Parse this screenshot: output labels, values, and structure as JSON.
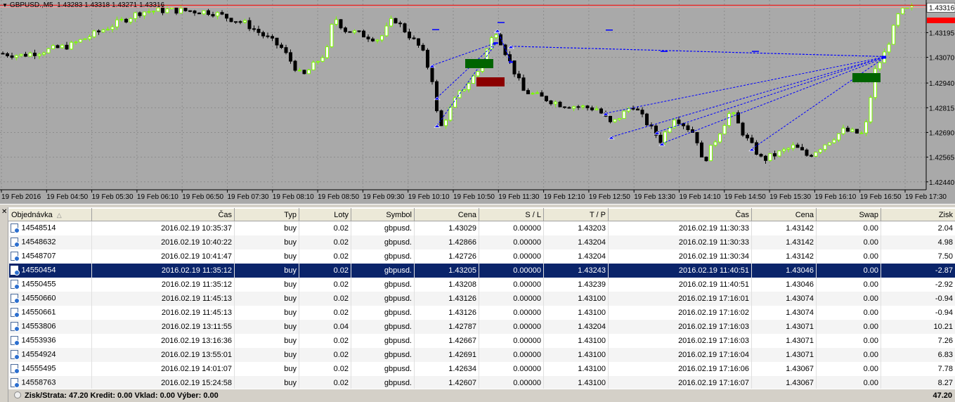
{
  "chart": {
    "symbol_label": "GBPUSD.,M5",
    "ohlc": "1.43283 1.43318 1.43271 1.43316",
    "current_price": "1.43316",
    "price_axis": [
      "1.43195",
      "1.43070",
      "1.42940",
      "1.42815",
      "1.42690",
      "1.42565",
      "1.42440"
    ],
    "time_axis": [
      "19 Feb 2016",
      "19 Feb 04:50",
      "19 Feb 05:30",
      "19 Feb 06:10",
      "19 Feb 06:50",
      "19 Feb 07:30",
      "19 Feb 08:10",
      "19 Feb 08:50",
      "19 Feb 09:30",
      "19 Feb 10:10",
      "19 Feb 10:50",
      "19 Feb 11:30",
      "19 Feb 12:10",
      "19 Feb 12:50",
      "19 Feb 13:30",
      "19 Feb 14:10",
      "19 Feb 14:50",
      "19 Feb 15:30",
      "19 Feb 16:10",
      "19 Feb 16:50",
      "19 Feb 17:30"
    ],
    "colors": {
      "background": "#a9a9a9",
      "bull": "#7cfc00",
      "bear": "#000000",
      "price_line": "#ff0000",
      "trade_line": "#0000ff",
      "tp_box": "#006400",
      "sl_box": "#8b0000"
    }
  },
  "table": {
    "headers": {
      "order": "Objednávka",
      "open_time": "Čas",
      "type": "Typ",
      "lots": "Loty",
      "symbol": "Symbol",
      "open_price": "Cena",
      "sl": "S / L",
      "tp": "T / P",
      "close_time": "Čas",
      "close_price": "Cena",
      "swap": "Swap",
      "profit": "Zisk"
    },
    "rows": [
      {
        "order": "14548514",
        "open_time": "2016.02.19 10:35:37",
        "type": "buy",
        "lots": "0.02",
        "symbol": "gbpusd.",
        "open_price": "1.43029",
        "sl": "0.00000",
        "tp": "1.43203",
        "close_time": "2016.02.19 11:30:33",
        "close_price": "1.43142",
        "swap": "0.00",
        "profit": "2.04"
      },
      {
        "order": "14548632",
        "open_time": "2016.02.19 10:40:22",
        "type": "buy",
        "lots": "0.02",
        "symbol": "gbpusd.",
        "open_price": "1.42866",
        "sl": "0.00000",
        "tp": "1.43204",
        "close_time": "2016.02.19 11:30:33",
        "close_price": "1.43142",
        "swap": "0.00",
        "profit": "4.98"
      },
      {
        "order": "14548707",
        "open_time": "2016.02.19 10:41:47",
        "type": "buy",
        "lots": "0.02",
        "symbol": "gbpusd.",
        "open_price": "1.42726",
        "sl": "0.00000",
        "tp": "1.43204",
        "close_time": "2016.02.19 11:30:34",
        "close_price": "1.43142",
        "swap": "0.00",
        "profit": "7.50"
      },
      {
        "order": "14550454",
        "open_time": "2016.02.19 11:35:12",
        "type": "buy",
        "lots": "0.02",
        "symbol": "gbpusd.",
        "open_price": "1.43205",
        "sl": "0.00000",
        "tp": "1.43243",
        "close_time": "2016.02.19 11:40:51",
        "close_price": "1.43046",
        "swap": "0.00",
        "profit": "-2.87"
      },
      {
        "order": "14550455",
        "open_time": "2016.02.19 11:35:12",
        "type": "buy",
        "lots": "0.02",
        "symbol": "gbpusd.",
        "open_price": "1.43208",
        "sl": "0.00000",
        "tp": "1.43239",
        "close_time": "2016.02.19 11:40:51",
        "close_price": "1.43046",
        "swap": "0.00",
        "profit": "-2.92"
      },
      {
        "order": "14550660",
        "open_time": "2016.02.19 11:45:13",
        "type": "buy",
        "lots": "0.02",
        "symbol": "gbpusd.",
        "open_price": "1.43126",
        "sl": "0.00000",
        "tp": "1.43100",
        "close_time": "2016.02.19 17:16:01",
        "close_price": "1.43074",
        "swap": "0.00",
        "profit": "-0.94"
      },
      {
        "order": "14550661",
        "open_time": "2016.02.19 11:45:13",
        "type": "buy",
        "lots": "0.02",
        "symbol": "gbpusd.",
        "open_price": "1.43126",
        "sl": "0.00000",
        "tp": "1.43100",
        "close_time": "2016.02.19 17:16:02",
        "close_price": "1.43074",
        "swap": "0.00",
        "profit": "-0.94"
      },
      {
        "order": "14553806",
        "open_time": "2016.02.19 13:11:55",
        "type": "buy",
        "lots": "0.04",
        "symbol": "gbpusd.",
        "open_price": "1.42787",
        "sl": "0.00000",
        "tp": "1.43204",
        "close_time": "2016.02.19 17:16:03",
        "close_price": "1.43071",
        "swap": "0.00",
        "profit": "10.21"
      },
      {
        "order": "14553936",
        "open_time": "2016.02.19 13:16:36",
        "type": "buy",
        "lots": "0.02",
        "symbol": "gbpusd.",
        "open_price": "1.42667",
        "sl": "0.00000",
        "tp": "1.43100",
        "close_time": "2016.02.19 17:16:03",
        "close_price": "1.43071",
        "swap": "0.00",
        "profit": "7.26"
      },
      {
        "order": "14554924",
        "open_time": "2016.02.19 13:55:01",
        "type": "buy",
        "lots": "0.02",
        "symbol": "gbpusd.",
        "open_price": "1.42691",
        "sl": "0.00000",
        "tp": "1.43100",
        "close_time": "2016.02.19 17:16:04",
        "close_price": "1.43071",
        "swap": "0.00",
        "profit": "6.83"
      },
      {
        "order": "14555495",
        "open_time": "2016.02.19 14:01:07",
        "type": "buy",
        "lots": "0.02",
        "symbol": "gbpusd.",
        "open_price": "1.42634",
        "sl": "0.00000",
        "tp": "1.43100",
        "close_time": "2016.02.19 17:16:06",
        "close_price": "1.43067",
        "swap": "0.00",
        "profit": "7.78"
      },
      {
        "order": "14558763",
        "open_time": "2016.02.19 15:24:58",
        "type": "buy",
        "lots": "0.02",
        "symbol": "gbpusd.",
        "open_price": "1.42607",
        "sl": "0.00000",
        "tp": "1.43100",
        "close_time": "2016.02.19 17:16:07",
        "close_price": "1.43067",
        "swap": "0.00",
        "profit": "8.27"
      }
    ],
    "selected_index": 3
  },
  "status": {
    "summary": "Zisk/Strata: 47.20  Kredit: 0.00  Vklad: 0.00  Výber: 0.00",
    "total": "47.20"
  }
}
